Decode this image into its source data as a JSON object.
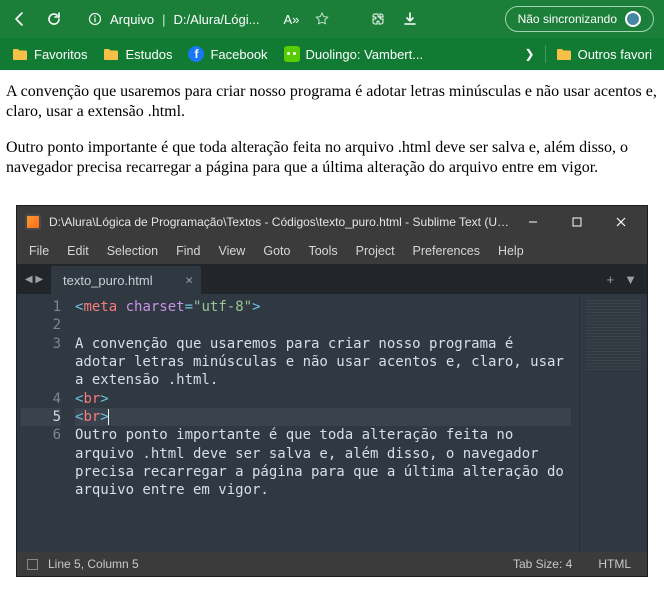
{
  "browser": {
    "address_icon_label": "Arquivo",
    "address_path": "D:/Alura/Lógi...",
    "reader_badge": "A»",
    "sync_label": "Não sincronizando"
  },
  "bookmarks": {
    "items": [
      {
        "label": "Favoritos",
        "icon": "folder"
      },
      {
        "label": "Estudos",
        "icon": "folder"
      },
      {
        "label": "Facebook",
        "icon": "fb"
      },
      {
        "label": "Duolingo: Vambert...",
        "icon": "duo"
      }
    ],
    "more_label": "Outros favori"
  },
  "page": {
    "p1": "A convenção que usaremos para criar nosso programa é adotar letras minúsculas e não usar acentos e, claro, usar a extensão .html.",
    "p2": "Outro ponto importante é que toda alteração feita no arquivo .html deve ser salva e, além disso, o navegador precisa recarregar a página para que a última alteração do arquivo entre em vigor."
  },
  "sublime": {
    "title": "D:\\Alura\\Lógica de Programação\\Textos - Códigos\\texto_puro.html - Sublime Text (UN...",
    "menus": [
      "File",
      "Edit",
      "Selection",
      "Find",
      "View",
      "Goto",
      "Tools",
      "Project",
      "Preferences",
      "Help"
    ],
    "tab_name": "texto_puro.html",
    "lines": {
      "n1": "1",
      "n2": "2",
      "n3": "3",
      "n4": "4",
      "n5": "5",
      "n6": "6"
    },
    "code": {
      "meta_open": "<",
      "meta_tag": "meta",
      "meta_space": " ",
      "meta_attr": "charset",
      "meta_eq": "=",
      "meta_val": "\"utf-8\"",
      "meta_close": ">",
      "text1": "A convenção que usaremos para criar nosso programa é adotar letras minúsculas e não usar acentos e, claro, usar a extensão .html.",
      "br_open": "<",
      "br_tag": "br",
      "br_close": ">",
      "text2": "Outro ponto importante é que toda alteração feita no arquivo .html deve ser salva e, além disso, o navegador precisa recarregar a página para que a última alteração do arquivo entre em vigor."
    },
    "status": {
      "pos": "Line 5, Column 5",
      "tab_size": "Tab Size: 4",
      "lang": "HTML"
    }
  }
}
